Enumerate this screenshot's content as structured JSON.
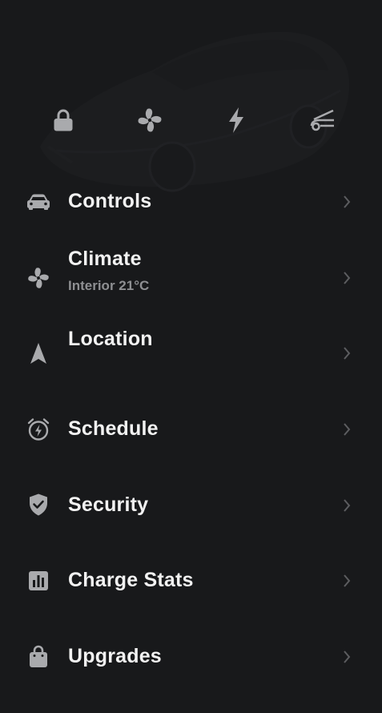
{
  "quick_actions": [
    {
      "icon": "lock-icon",
      "label": ""
    },
    {
      "icon": "fan-icon",
      "label": ""
    },
    {
      "icon": "lightning-bolt-icon",
      "label": ""
    },
    {
      "icon": "frunk-icon",
      "label": ""
    }
  ],
  "menu": {
    "items": [
      {
        "id": "controls",
        "icon": "car-icon",
        "label": "Controls",
        "sub": ""
      },
      {
        "id": "climate",
        "icon": "fan-icon",
        "label": "Climate",
        "sub": "Interior 21°C"
      },
      {
        "id": "location",
        "icon": "navigation-arrow-icon",
        "label": "Location",
        "sub": ""
      },
      {
        "id": "schedule",
        "icon": "alarm-clock-bolt-icon",
        "label": "Schedule",
        "sub": ""
      },
      {
        "id": "security",
        "icon": "shield-check-icon",
        "label": "Security",
        "sub": ""
      },
      {
        "id": "charge_stats",
        "icon": "bar-chart-icon",
        "label": "Charge Stats",
        "sub": ""
      },
      {
        "id": "upgrades",
        "icon": "shopping-bag-icon",
        "label": "Upgrades",
        "sub": ""
      }
    ]
  },
  "colors": {
    "background": "#18191b",
    "text_primary": "#f2f2f2",
    "text_secondary": "#8e8f92",
    "icon": "#a9aaad",
    "chevron": "#5c5d60"
  }
}
